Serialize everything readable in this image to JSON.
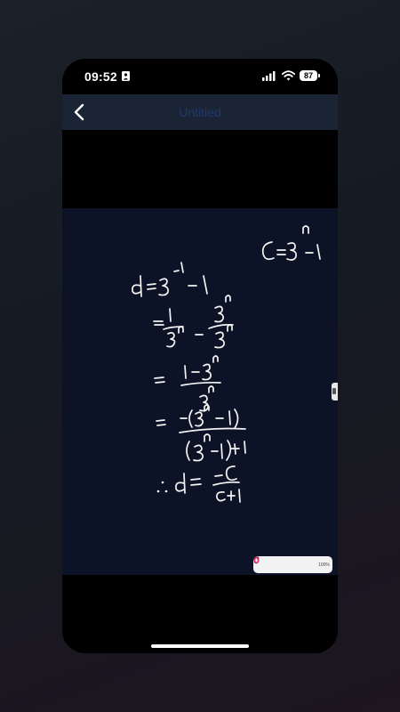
{
  "status_bar": {
    "time": "09:52",
    "battery": "87",
    "icons": [
      "person-icon",
      "signal-icon",
      "wifi-icon",
      "battery-icon"
    ]
  },
  "nav": {
    "back_icon": "chevron-left-icon",
    "title": "Untitled"
  },
  "canvas": {
    "background_color": "#0c1327",
    "ink_color": "#f4f4f4",
    "handwriting": [
      "C = 3^n - 1",
      "d = 3^-1 - 1",
      "= 1/3^n - 3^n/3^n",
      "= (1 - 3^n)/3^n",
      "= -(3^n - 1)/((3^n - 1) + 1)",
      "∴ d = -C/(C+1)"
    ]
  },
  "toolbar": {
    "tools": [
      "chevron-icon",
      "pen-icon",
      "marker-icon",
      "eraser-icon",
      "undo-icon",
      "redo-icon",
      "lasso-icon",
      "color-icon"
    ],
    "zoom": "100%"
  }
}
